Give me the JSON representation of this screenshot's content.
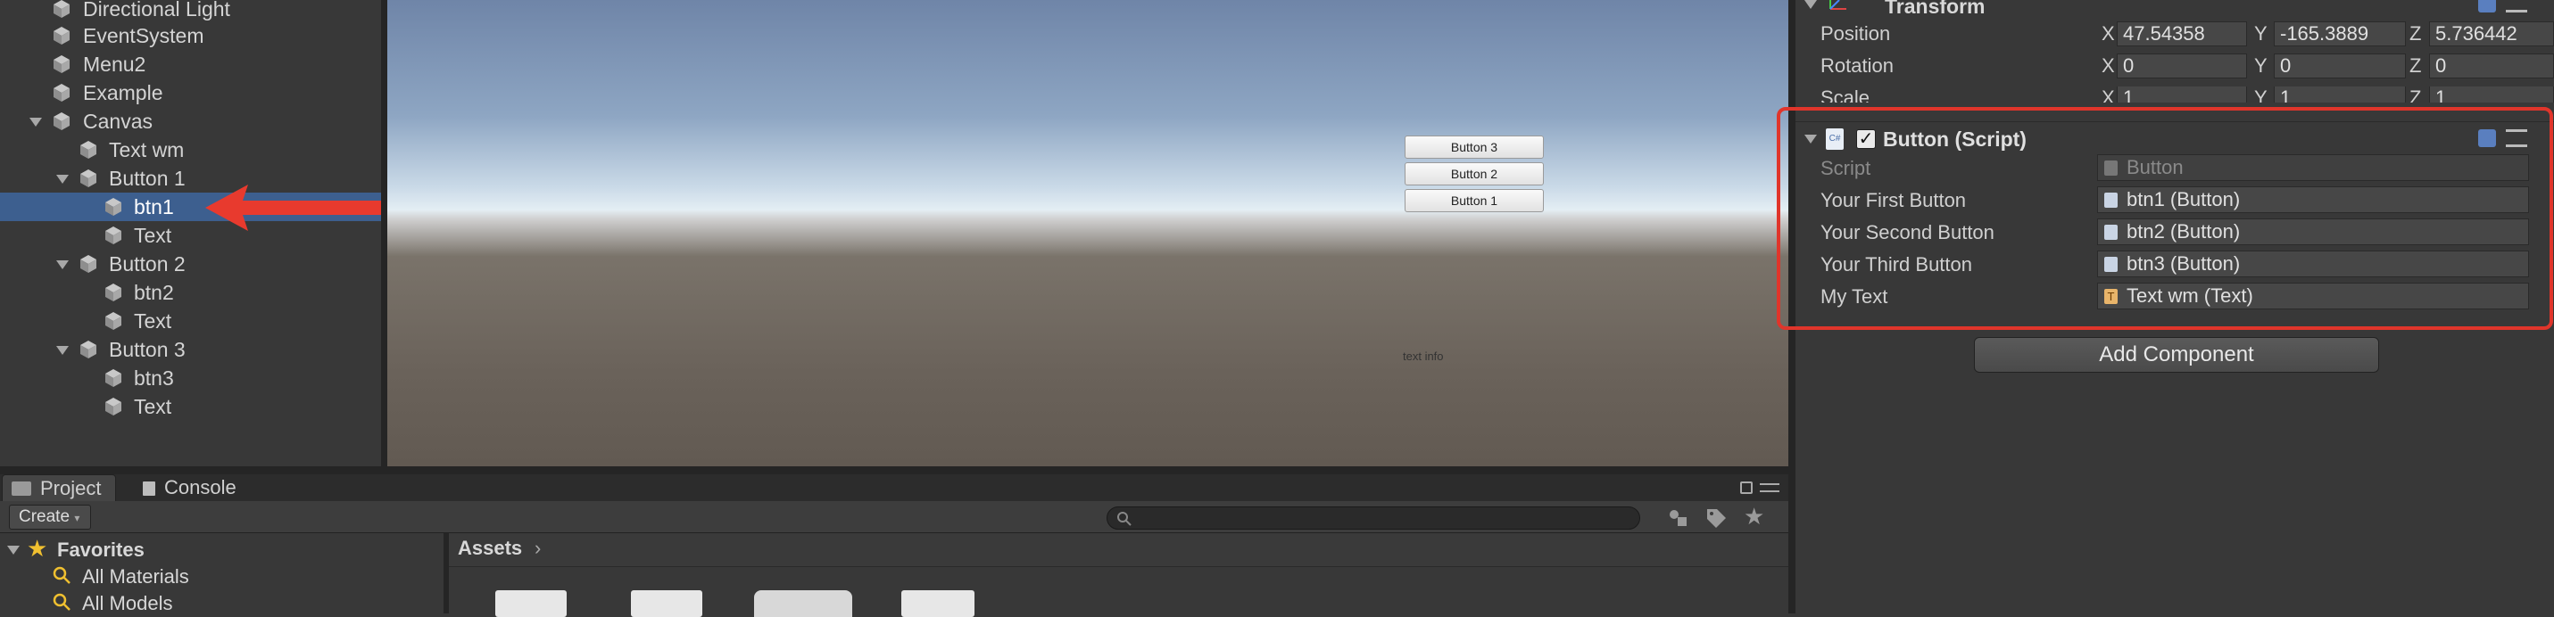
{
  "hierarchy": {
    "items": [
      {
        "label": "Directional Light"
      },
      {
        "label": "EventSystem"
      },
      {
        "label": "Menu2"
      },
      {
        "label": "Example"
      },
      {
        "label": "Canvas"
      },
      {
        "label": "Text wm"
      },
      {
        "label": "Button 1"
      },
      {
        "label": "btn1"
      },
      {
        "label": "Text"
      },
      {
        "label": "Button 2"
      },
      {
        "label": "btn2"
      },
      {
        "label": "Text"
      },
      {
        "label": "Button 3"
      },
      {
        "label": "btn3"
      },
      {
        "label": "Text"
      }
    ]
  },
  "scene": {
    "buttons": [
      {
        "label": "Button 3"
      },
      {
        "label": "Button 2"
      },
      {
        "label": "Button 1"
      }
    ],
    "text_info": "text info"
  },
  "inspector": {
    "transform": {
      "title": "Transform",
      "position_label": "Position",
      "rotation_label": "Rotation",
      "scale_label": "Scale",
      "axis_x": "X",
      "axis_y": "Y",
      "axis_z": "Z",
      "position": {
        "x": "47.54358",
        "y": "-165.3889",
        "z": "5.736442"
      },
      "rotation": {
        "x": "0",
        "y": "0",
        "z": "0"
      },
      "scale": {
        "x": "1",
        "y": "1",
        "z": "1"
      }
    },
    "button_script": {
      "title": "Button (Script)",
      "script_label": "Script",
      "script_value": "Button",
      "fields": [
        {
          "label": "Your First Button",
          "value": "btn1 (Button)"
        },
        {
          "label": "Your Second Button",
          "value": "btn2 (Button)"
        },
        {
          "label": "Your Third Button",
          "value": "btn3 (Button)"
        },
        {
          "label": "My Text",
          "value": "Text wm (Text)"
        }
      ]
    },
    "add_component": "Add Component"
  },
  "project": {
    "tabs": {
      "project": "Project",
      "console": "Console"
    },
    "create_label": "Create",
    "favorites_label": "Favorites",
    "favorites": [
      {
        "label": "All Materials"
      },
      {
        "label": "All Models"
      }
    ],
    "assets_label": "Assets"
  },
  "colors": {
    "selection": "#3d5f8f",
    "highlight": "#e0352b"
  }
}
